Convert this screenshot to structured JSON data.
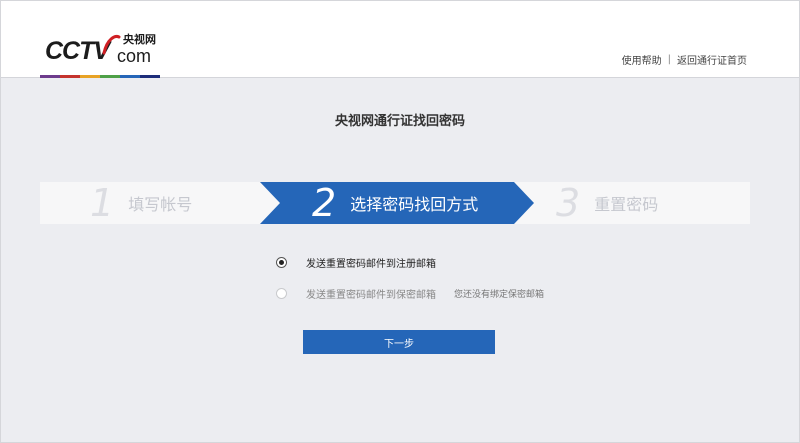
{
  "header": {
    "logo_text": "CCTV",
    "logo_domain": "com",
    "logo_cn": "央视网",
    "links": [
      "使用帮助",
      "返回通行证首页"
    ],
    "separator": "|"
  },
  "page_title": "央视网通行证找回密码",
  "steps": [
    {
      "num": "1",
      "label": "填写帐号",
      "active": false
    },
    {
      "num": "2",
      "label": "选择密码找回方式",
      "active": true
    },
    {
      "num": "3",
      "label": "重置密码",
      "active": false
    }
  ],
  "options": [
    {
      "label": "发送重置密码邮件到注册邮箱",
      "selected": true,
      "enabled": true,
      "note": ""
    },
    {
      "label": "发送重置密码邮件到保密邮箱",
      "selected": false,
      "enabled": false,
      "note": "您还没有绑定保密邮箱"
    }
  ],
  "next_button": "下一步",
  "colors": {
    "accent": "#2566b8",
    "logo_red": "#cf1f24",
    "brand_stripes": [
      "#6d3b8c",
      "#c5342d",
      "#e8a325",
      "#4ea047",
      "#2566b8",
      "#1d2d7a"
    ]
  }
}
